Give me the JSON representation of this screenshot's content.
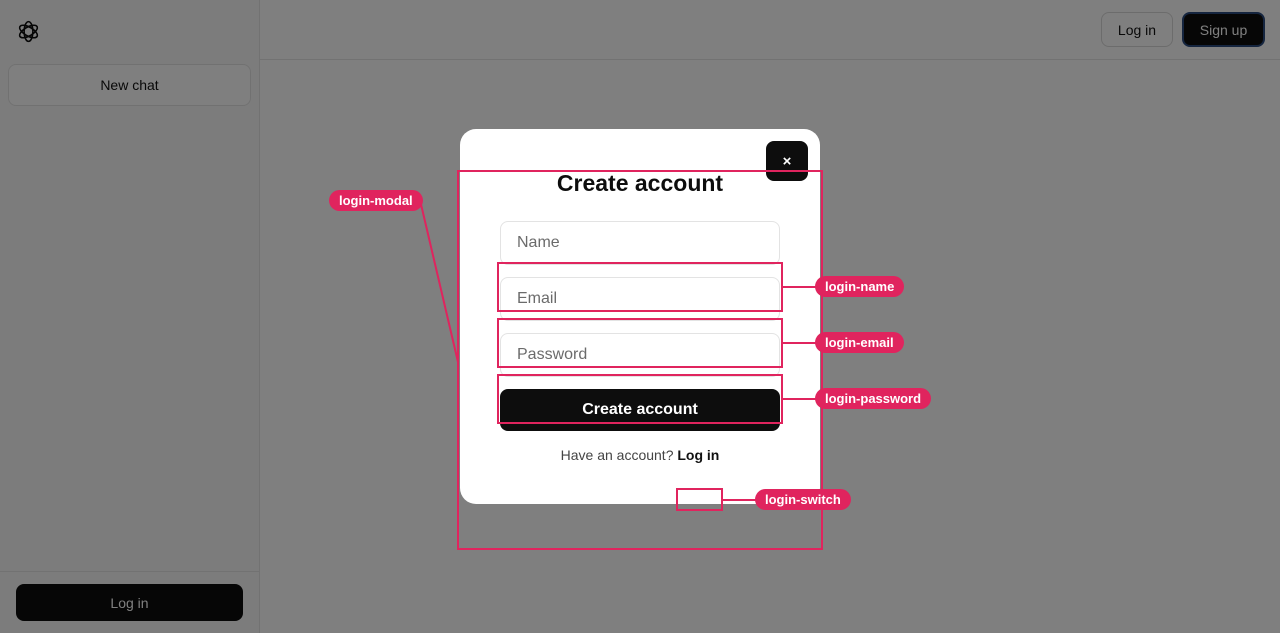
{
  "sidebar": {
    "logo_icon": "openai-logo-icon",
    "new_chat_label": "New chat",
    "login_label": "Log in"
  },
  "topbar": {
    "login_label": "Log in",
    "signup_label": "Sign up"
  },
  "modal": {
    "close_symbol": "×",
    "title": "Create account",
    "name_placeholder": "Name",
    "email_placeholder": "Email",
    "password_placeholder": "Password",
    "submit_label": "Create account",
    "switch_prompt": "Have an account?",
    "switch_link": "Log in"
  },
  "annotations": {
    "modal_tag": "login-modal",
    "name_tag": "login-name",
    "email_tag": "login-email",
    "password_tag": "login-password",
    "switch_tag": "login-switch"
  },
  "colors": {
    "accent": "#e0245e",
    "button_dark": "#0d0d0d",
    "overlay": "rgba(0,0,0,0.5)"
  }
}
